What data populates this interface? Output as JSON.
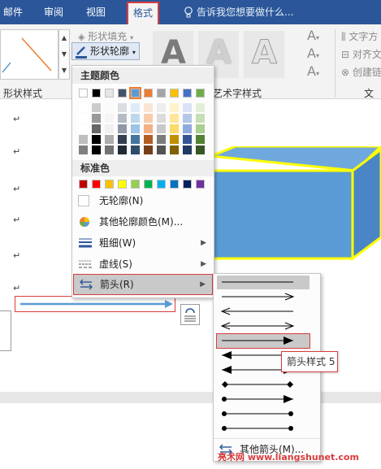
{
  "tabs": {
    "mail": "邮件",
    "review": "审阅",
    "view": "视图",
    "format": "格式"
  },
  "tell_me": "告诉我您想要做什么...",
  "ribbon": {
    "shape_fill": "形状填充",
    "shape_outline": "形状轮廓",
    "shape_styles_label": "形状样式",
    "wordart_styles_label": "艺术字样式",
    "wordart_letter": "A",
    "text_direction": "文字方",
    "align_text": "对齐文",
    "create_link": "创建链",
    "text_label": "文本"
  },
  "menu": {
    "theme_colors": "主题颜色",
    "standard_colors": "标准色",
    "no_outline": "无轮廓(N)",
    "more_colors": "其他轮廓颜色(M)...",
    "weight": "粗细(W)",
    "dashes": "虚线(S)",
    "arrows": "箭头(R)"
  },
  "submenu": {
    "more_arrows": "其他箭头(M)..."
  },
  "tooltip": "箭头样式 5",
  "paragraph_mark": "↵",
  "watermark": "亮术网 www.liangshunet.com",
  "colors": {
    "accent": "#2b579a",
    "highlight_red": "#d83c3c",
    "cube_fill": "#5b9bd5",
    "cube_outline": "#ffff00",
    "arrow_line": "#5b9bd5",
    "theme_top": [
      "#ffffff",
      "#000000",
      "#e7e6e6",
      "#44546a",
      "#5b9bd5",
      "#ed7d31",
      "#a5a5a5",
      "#ffc000",
      "#4472c4",
      "#70ad47"
    ],
    "standard": [
      "#c00000",
      "#ff0000",
      "#ffc000",
      "#ffff00",
      "#92d050",
      "#00b050",
      "#00b0f0",
      "#0070c0",
      "#002060",
      "#7030a0"
    ]
  }
}
